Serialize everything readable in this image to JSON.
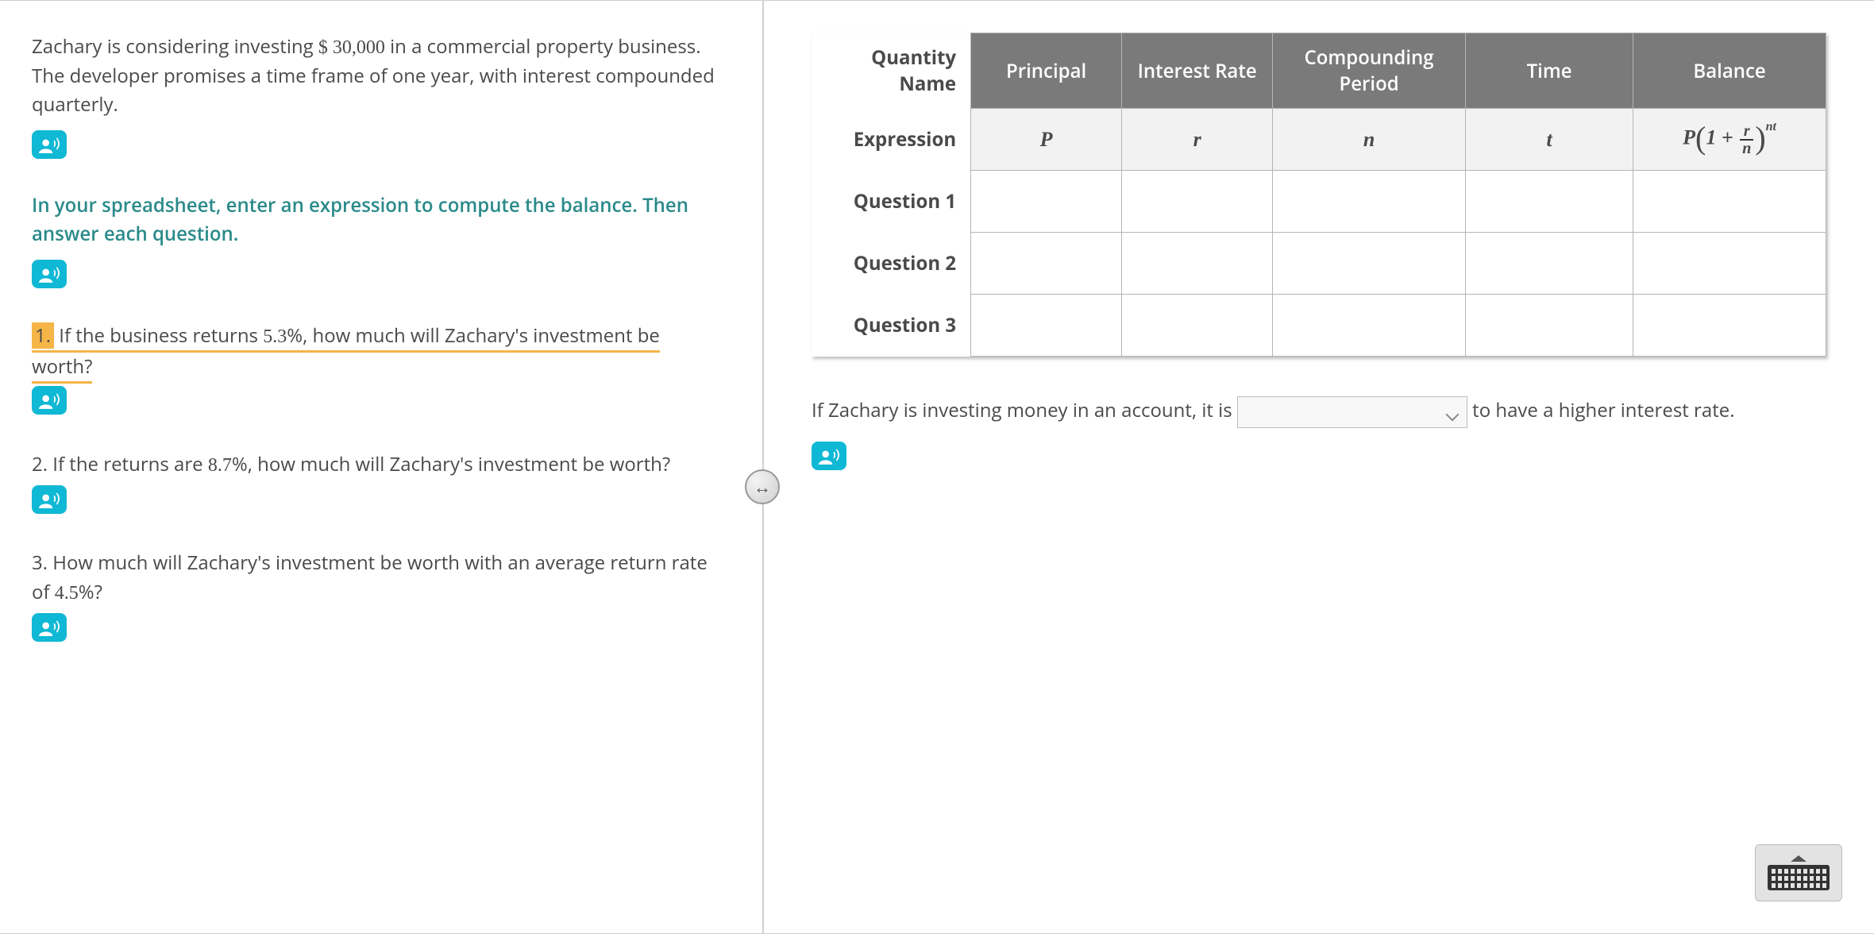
{
  "problem": {
    "intro_pre": "Zachary is considering investing ",
    "amount": "$ 30,000",
    "intro_post": " in a commercial property business. The developer promises a time frame of one year, with interest compounded quarterly.",
    "instruction": "In your spreadsheet, enter an expression to compute the balance. Then answer each question.",
    "questions": [
      {
        "num": "1.",
        "pre": "If the business returns ",
        "rate": "5.3",
        "post": "%, how much will Zachary's investment be worth?"
      },
      {
        "num": "2.",
        "pre": "If the returns are ",
        "rate": "8.7",
        "post": "%, how much will Zachary's investment be worth?"
      },
      {
        "num": "3.",
        "pre": "How much will Zachary's investment be worth with an average return rate of ",
        "rate": "4.5",
        "post": "%?"
      }
    ]
  },
  "table": {
    "header_rowlabel": "Quantity Name",
    "columns": [
      "Principal",
      "Interest Rate",
      "Compounding Period",
      "Time",
      "Balance"
    ],
    "expression_row_label": "Expression",
    "expressions": {
      "P": "P",
      "r": "r",
      "n": "n",
      "t": "t"
    },
    "formula": {
      "P": "P",
      "one": "1",
      "plus": "+",
      "num": "r",
      "den": "n",
      "exp": "nt"
    },
    "question_rows": [
      "Question 1",
      "Question 2",
      "Question 3"
    ]
  },
  "fill_in": {
    "part1": "If Zachary is investing money in an account, it is ",
    "part2": " to have a higher interest rate."
  },
  "chart_data": {
    "type": "table",
    "title": "Compound interest formula inputs",
    "columns": [
      "Quantity Name",
      "Principal",
      "Interest Rate",
      "Compounding Period",
      "Time",
      "Balance"
    ],
    "rows": [
      [
        "Expression",
        "P",
        "r",
        "n",
        "t",
        "P(1 + r/n)^(nt)"
      ],
      [
        "Question 1",
        "",
        "",
        "",
        "",
        ""
      ],
      [
        "Question 2",
        "",
        "",
        "",
        "",
        ""
      ],
      [
        "Question 3",
        "",
        "",
        "",
        "",
        ""
      ]
    ],
    "context": {
      "principal": 30000,
      "compounding_per_year": 4,
      "time_years": 1,
      "rates": {
        "q1": 0.053,
        "q2": 0.087,
        "q3": 0.045
      }
    }
  }
}
